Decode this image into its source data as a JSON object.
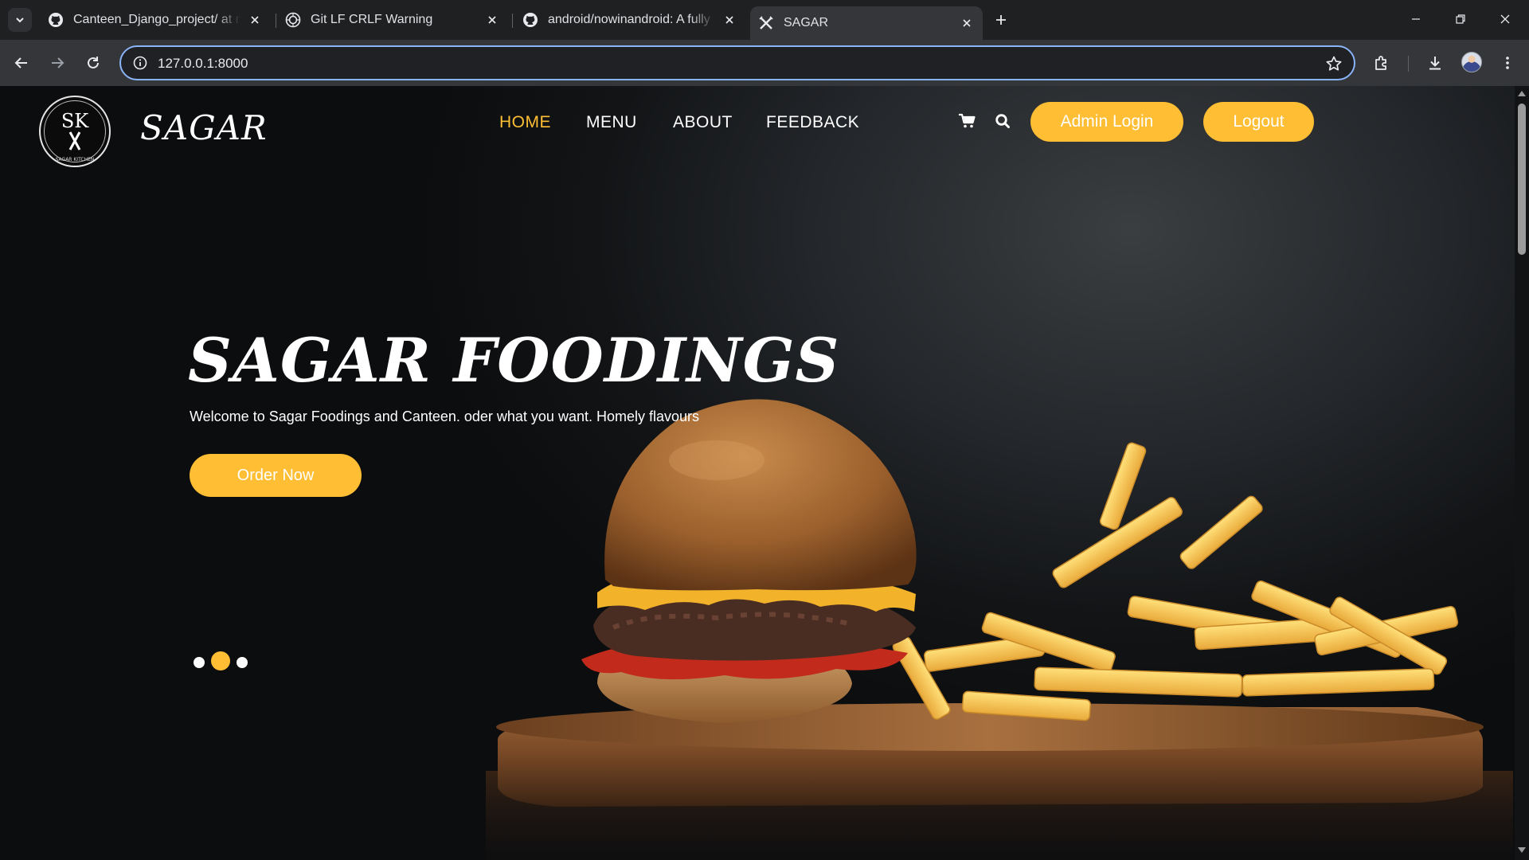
{
  "browser": {
    "tabs": [
      {
        "title": "Canteen_Django_project/ at ma",
        "favicon": "github-icon",
        "active": false
      },
      {
        "title": "Git LF CRLF Warning",
        "favicon": "openai-icon",
        "active": false
      },
      {
        "title": "android/nowinandroid: A fully f",
        "favicon": "github-icon",
        "active": false
      },
      {
        "title": "SAGAR",
        "favicon": "fork-knife-icon",
        "active": true
      }
    ],
    "address": "127.0.0.1:8000"
  },
  "site": {
    "logo_monogram": "SK",
    "logo_ring_text": "SAGAR KITCHEN",
    "brand": "SAGAR",
    "nav": [
      {
        "label": "HOME",
        "active": true
      },
      {
        "label": "MENU",
        "active": false
      },
      {
        "label": "ABOUT",
        "active": false
      },
      {
        "label": "FEEDBACK",
        "active": false
      }
    ],
    "admin_login": "Admin Login",
    "logout": "Logout"
  },
  "hero": {
    "title": "SAGAR FOODINGS",
    "subtitle": "Welcome to Sagar Foodings and Canteen. oder what you want. Homely flavours",
    "cta": "Order Now",
    "carousel": {
      "slides": 3,
      "active_index": 1
    }
  },
  "colors": {
    "accent": "#ffbe33",
    "chrome_bg": "#1f2022",
    "toolbar_bg": "#35363a",
    "omnibox_border": "#8ab4f8"
  }
}
